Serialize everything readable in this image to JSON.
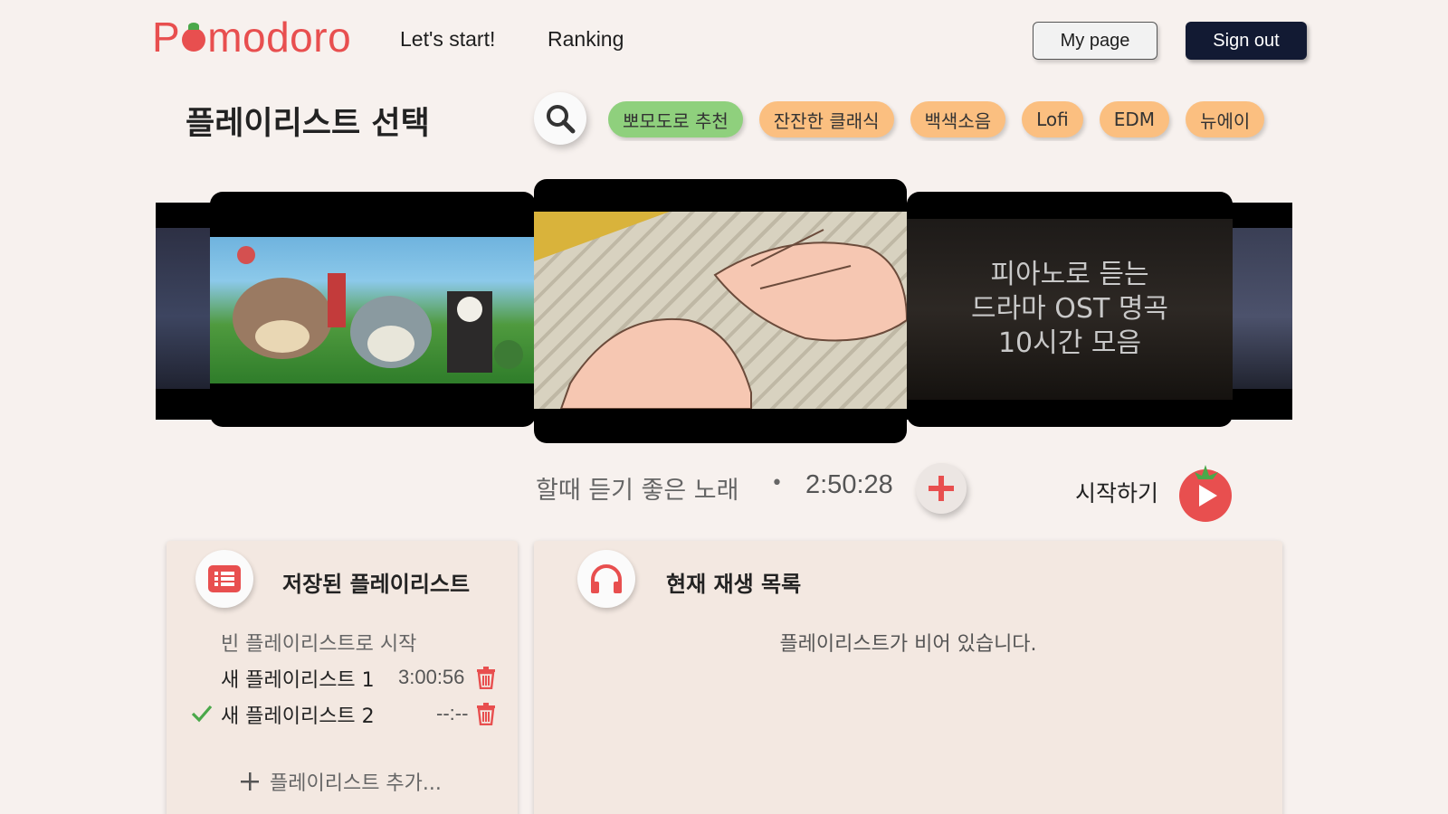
{
  "header": {
    "logo_prefix": "P",
    "logo_suffix": "modoro",
    "nav": [
      "Let's start!",
      "Ranking"
    ],
    "mypage_label": "My page",
    "signout_label": "Sign out"
  },
  "playlist_select": {
    "title": "플레이리스트 선택",
    "chips": [
      {
        "label": "뽀모도로 추천",
        "active": true
      },
      {
        "label": "잔잔한 클래식",
        "active": false
      },
      {
        "label": "백색소음",
        "active": false
      },
      {
        "label": "Lofi",
        "active": false
      },
      {
        "label": "EDM",
        "active": false
      },
      {
        "label": "뉴에이",
        "active": false
      }
    ]
  },
  "carousel": {
    "right_card_lines": [
      "피아노로 듣는",
      "드라마 OST 명곡",
      "10시간 모음"
    ]
  },
  "now_playing": {
    "title": "할때 듣기 좋은 노래",
    "separator": "•",
    "duration": "2:50:28",
    "start_label": "시작하기"
  },
  "saved_panel": {
    "title": "저장된 플레이리스트",
    "empty_start": "빈 플레이리스트로 시작",
    "items": [
      {
        "name": "새 플레이리스트 1",
        "duration": "3:00:56",
        "selected": false
      },
      {
        "name": "새 플레이리스트 2",
        "duration": "--:--",
        "selected": true
      }
    ],
    "add_label": "플레이리스트 추가..."
  },
  "queue_panel": {
    "title": "현재 재생 목록",
    "empty_message": "플레이리스트가 비어 있습니다."
  },
  "colors": {
    "background": "#f7f1ee",
    "brand_red": "#e84f4f",
    "chip_orange": "#fbbf80",
    "chip_green": "#8fd07d",
    "signout_navy": "#121a33",
    "check_green": "#4aa84a"
  }
}
